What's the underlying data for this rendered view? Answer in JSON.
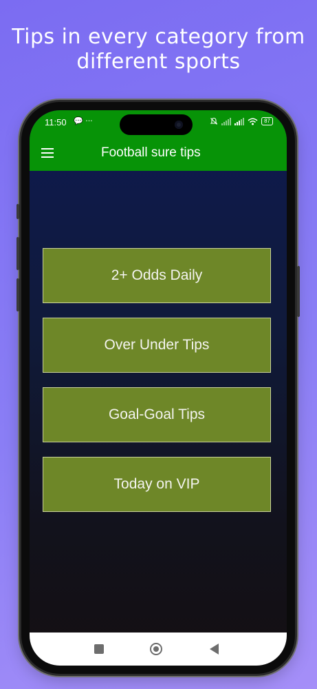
{
  "headline": {
    "line1": "Tips in every category from",
    "line2": "different sports"
  },
  "status_bar": {
    "time": "11:50",
    "left_icons": "💬 ···",
    "battery": "87",
    "icons": [
      "message-icon",
      "more-dots-icon",
      "mute-icon",
      "signal-icon",
      "signal-icon",
      "wifi-icon",
      "battery-icon"
    ]
  },
  "app_bar": {
    "title": "Football sure tips",
    "menu_icon": "hamburger-menu-icon"
  },
  "buttons": [
    {
      "label": "2+ Odds Daily"
    },
    {
      "label": "Over Under Tips"
    },
    {
      "label": "Goal-Goal Tips"
    },
    {
      "label": "Today on VIP"
    }
  ],
  "colors": {
    "app_bar": "#079307",
    "button_fill": "#6e8728",
    "button_border": "#c9d19a",
    "background": "#7b6cf2"
  },
  "nav_bar": {
    "icons": [
      "recents-square-icon",
      "home-circle-icon",
      "back-triangle-icon"
    ]
  }
}
